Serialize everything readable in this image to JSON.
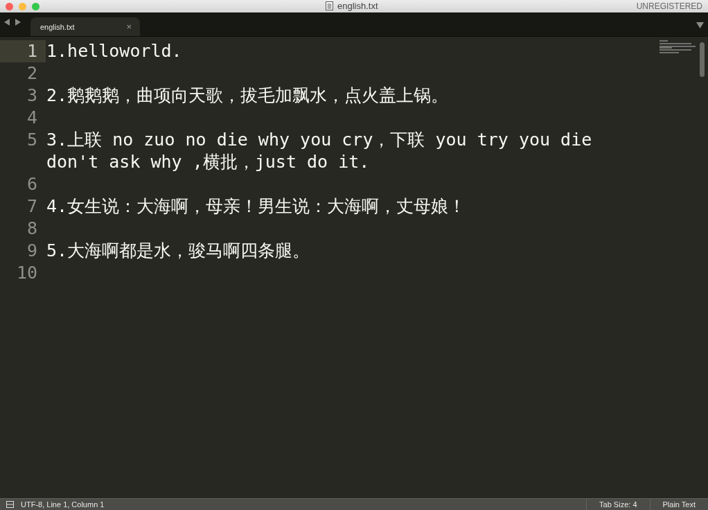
{
  "window": {
    "title": "english.txt",
    "license": "UNREGISTERED"
  },
  "tabs": [
    {
      "label": "english.txt",
      "selected": true,
      "close": "×"
    }
  ],
  "editor": {
    "lines": [
      {
        "number": "1",
        "text": "1.helloworld.",
        "current": true
      },
      {
        "number": "2",
        "current": false
      },
      {
        "number": "3",
        "text": "2.鹅鹅鹅，曲项向天歌，拔毛加飘水，点火盖上锅。",
        "current": false
      },
      {
        "number": "4",
        "current": false
      },
      {
        "number": "5",
        "text": "3.上联 no zuo no die why you cry，下联 you try you die don't ask why ,横批，just do it.",
        "current": false
      },
      {
        "number": "6",
        "current": false
      },
      {
        "number": "7",
        "text": "4.女生说：大海啊，母亲！男生说：大海啊，丈母娘！",
        "current": false
      },
      {
        "number": "8",
        "current": false
      },
      {
        "number": "9",
        "text": "5.大海啊都是水，骏马啊四条腿。",
        "current": false
      },
      {
        "number": "10",
        "current": false
      }
    ]
  },
  "status_bar": {
    "position": "UTF-8, Line 1, Column 1",
    "tab_size": "Tab Size: 4",
    "syntax": "Plain Text"
  }
}
